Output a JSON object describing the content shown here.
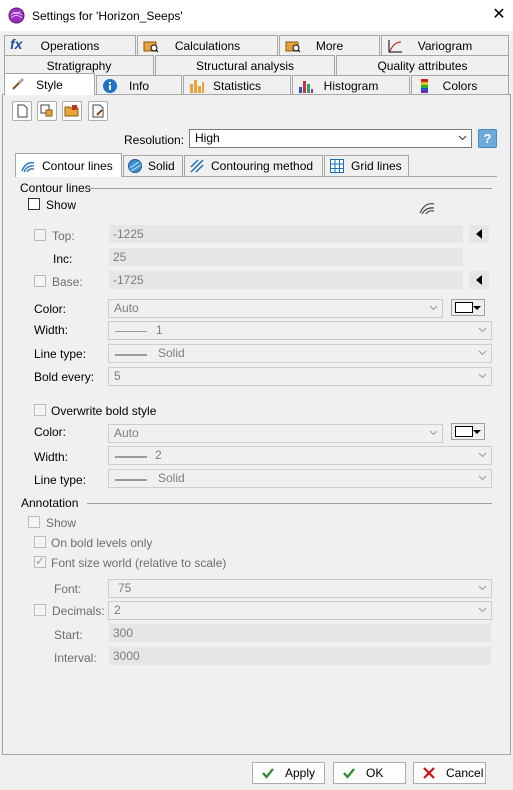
{
  "window": {
    "title": "Settings for 'Horizon_Seeps'",
    "close_icon": "close-icon"
  },
  "tabs_row1": [
    {
      "label": "Operations",
      "icon": "fx-icon"
    },
    {
      "label": "Calculations",
      "icon": "folder-search-icon"
    },
    {
      "label": "More",
      "icon": "folder-search-icon"
    },
    {
      "label": "Variogram",
      "icon": "variogram-icon"
    }
  ],
  "tabs_row2": [
    {
      "label": "Stratigraphy"
    },
    {
      "label": "Structural analysis"
    },
    {
      "label": "Quality attributes"
    }
  ],
  "tabs_row3": [
    {
      "label": "Style",
      "icon": "brush-icon",
      "active": true
    },
    {
      "label": "Info",
      "icon": "info-icon"
    },
    {
      "label": "Statistics",
      "icon": "statistics-icon"
    },
    {
      "label": "Histogram",
      "icon": "histogram-icon"
    },
    {
      "label": "Colors",
      "icon": "colors-icon"
    }
  ],
  "toolbar": [
    "new-icon",
    "copy-style-icon",
    "folder-open-icon",
    "save-style-icon"
  ],
  "resolution": {
    "label": "Resolution:",
    "value": "High",
    "help": "?"
  },
  "inner_tabs": [
    {
      "label": "Contour lines",
      "icon": "contour-icon",
      "active": true
    },
    {
      "label": "Solid",
      "icon": "solid-icon"
    },
    {
      "label": "Contouring method",
      "icon": "contouring-method-icon"
    },
    {
      "label": "Grid lines",
      "icon": "grid-icon"
    }
  ],
  "contour": {
    "group_label": "Contour lines",
    "show_label": "Show",
    "top_label": "Top:",
    "top_value": "-1225",
    "inc_label": "Inc:",
    "inc_value": "25",
    "base_label": "Base:",
    "base_value": "-1725",
    "color_label": "Color:",
    "color_value": "Auto",
    "width_label": "Width:",
    "width_value": "1",
    "linetype_label": "Line type:",
    "linetype_value": "Solid",
    "bold_label": "Bold every:",
    "bold_value": "5",
    "overwrite_label": "Overwrite bold style",
    "color2_label": "Color:",
    "color2_value": "Auto",
    "width2_label": "Width:",
    "width2_value": "2",
    "linetype2_label": "Line type:",
    "linetype2_value": "Solid"
  },
  "annotation": {
    "group_label": "Annotation",
    "show_label": "Show",
    "bold_only_label": "On bold levels only",
    "font_world_label": "Font size world (relative to scale)",
    "font_label": "Font:",
    "font_value": "75",
    "decimals_label": "Decimals:",
    "decimals_value": "2",
    "start_label": "Start:",
    "start_value": "300",
    "interval_label": "Interval:",
    "interval_value": "3000"
  },
  "buttons": {
    "apply": "Apply",
    "ok": "OK",
    "cancel": "Cancel"
  },
  "colors": {
    "accent": "#6ea9dc",
    "check_green": "#2e8b2e",
    "cancel_red": "#cc1111"
  }
}
